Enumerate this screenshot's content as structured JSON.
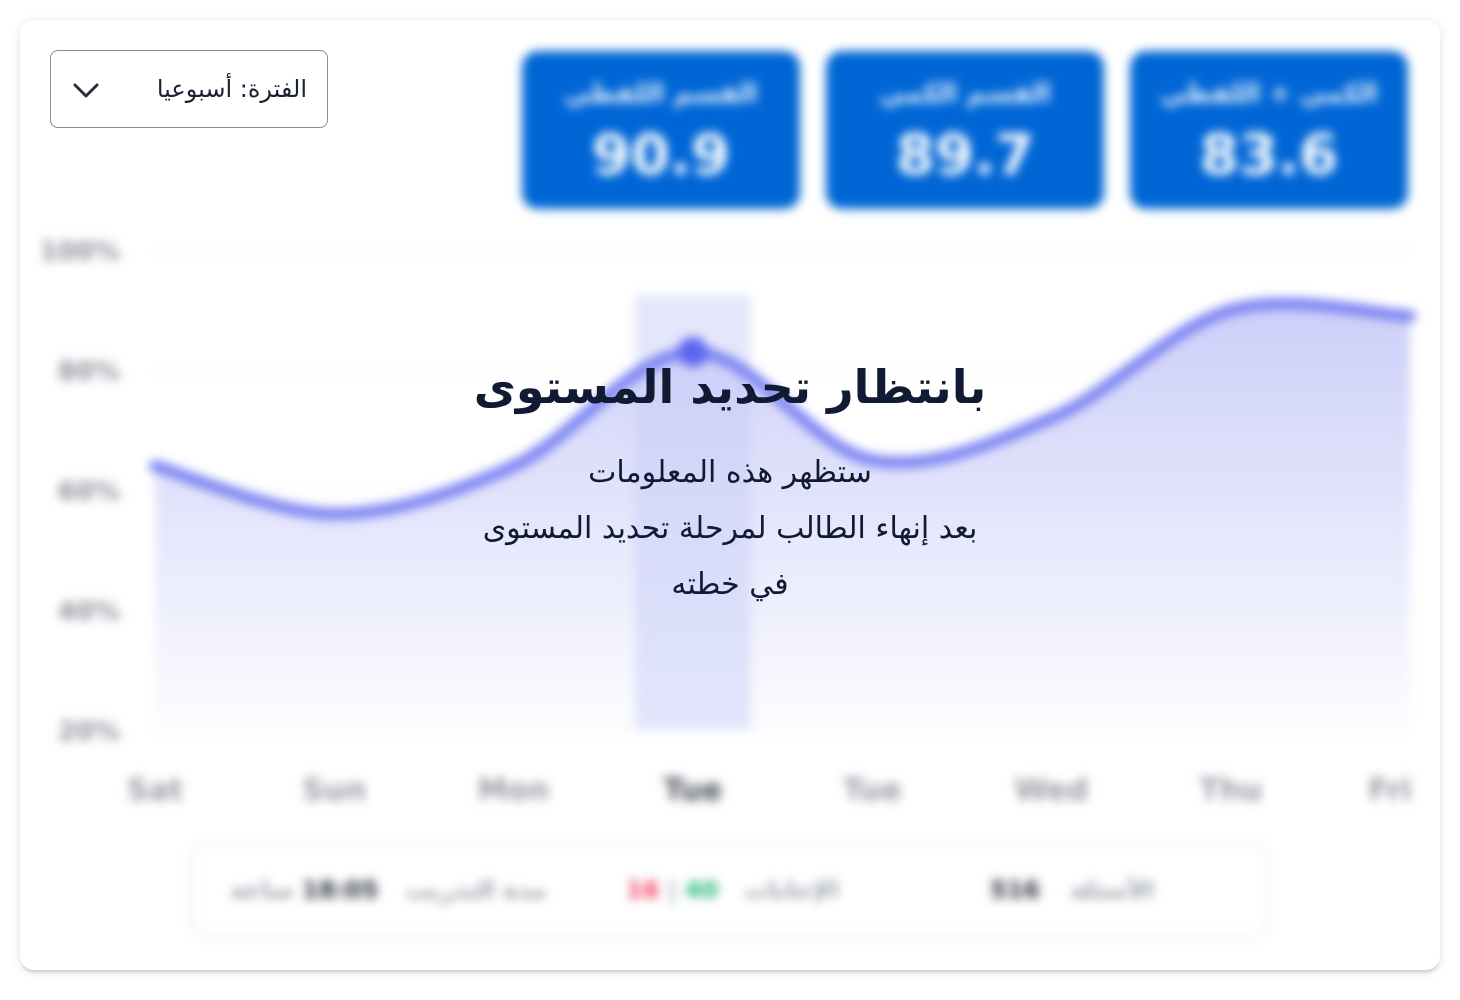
{
  "period_selector": {
    "label": "الفترة: أسبوعيا",
    "icon": "chevron-down-icon"
  },
  "stats": [
    {
      "label": "الكمي + اللفظي",
      "value": "83.6"
    },
    {
      "label": "القسم الكمي",
      "value": "89.7"
    },
    {
      "label": "القسم اللفظي",
      "value": "90.9"
    }
  ],
  "chart_data": {
    "type": "area",
    "categories": [
      "Sat",
      "Sun",
      "Mon",
      "Tue",
      "Tue",
      "Wed",
      "Thu",
      "Fri"
    ],
    "values": [
      64,
      56,
      64,
      83,
      65,
      72,
      90,
      89
    ],
    "highlight_index": 3,
    "y_ticks": [
      "20%",
      "40%",
      "60%",
      "80%",
      "100%"
    ],
    "ylim": [
      20,
      100
    ],
    "grid": true,
    "colors": {
      "line": "#7b83f2",
      "fill": "#c9ccf8",
      "marker": "#5d66f0",
      "highlight": "#e4e7fb"
    }
  },
  "summary": {
    "questions_label": "الأسئلة",
    "questions_value": "516",
    "answers_label": "الإجابات",
    "answers_correct": "40",
    "answers_separator": "|",
    "answers_wrong": "16",
    "duration_label": "مدة التدريب",
    "duration_value": "18:05",
    "duration_unit": "ساعة"
  },
  "overlay": {
    "title": "بانتظار تحديد المستوى",
    "line1": "ستظهر هذه المعلومات",
    "line2": "بعد إنهاء الطالب لمرحلة تحديد المستوى",
    "line3": "في خطته"
  }
}
